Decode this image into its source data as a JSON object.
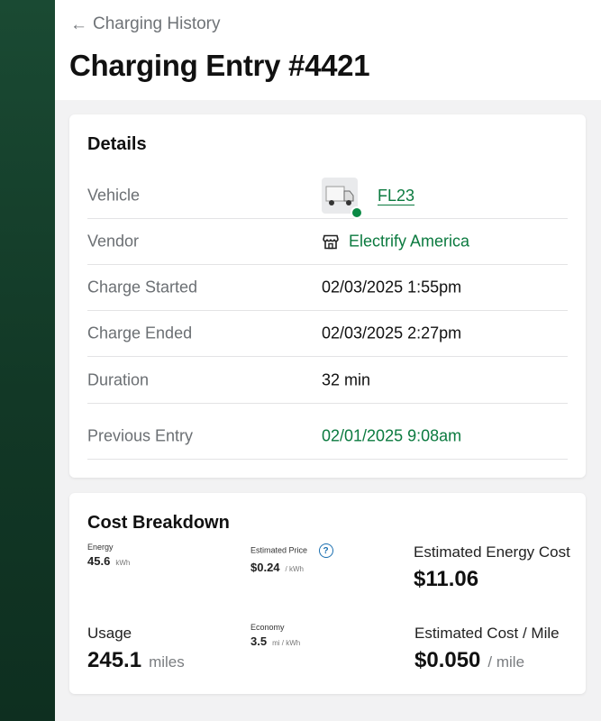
{
  "header": {
    "back_label": "Charging History",
    "title": "Charging Entry #4421"
  },
  "details": {
    "title": "Details",
    "rows": [
      {
        "label": "Vehicle",
        "value": "FL23"
      },
      {
        "label": "Vendor",
        "value": "Electrify America"
      },
      {
        "label": "Charge Started",
        "value": "02/03/2025 1:55pm"
      },
      {
        "label": "Charge Ended",
        "value": "02/03/2025 2:27pm"
      },
      {
        "label": "Duration",
        "value": "32 min"
      },
      {
        "label": "Previous Entry",
        "value": "02/01/2025 9:08am"
      }
    ]
  },
  "cost": {
    "title": "Cost Breakdown",
    "energy": {
      "label": "Energy",
      "value": "45.6",
      "unit": "kWh"
    },
    "price": {
      "label": "Estimated Price",
      "value": "$0.24",
      "unit": "/ kWh",
      "help": "?"
    },
    "energy_cost": {
      "label": "Estimated Energy Cost",
      "value": "$11.06"
    },
    "usage": {
      "label": "Usage",
      "value": "245.1",
      "unit": "miles"
    },
    "economy": {
      "label": "Economy",
      "value": "3.5",
      "unit": "mi / kWh"
    },
    "cost_per_mile": {
      "label": "Estimated Cost / Mile",
      "value": "$0.050",
      "unit": "/ mile"
    }
  },
  "colors": {
    "accent_green": "#0b7a3f",
    "sidebar_green": "#123826",
    "help_blue": "#1a6fb0"
  },
  "icons": {
    "back": "arrow-left-icon",
    "vehicle": "truck-thumbnail",
    "vendor": "store-icon",
    "help": "help-icon"
  }
}
